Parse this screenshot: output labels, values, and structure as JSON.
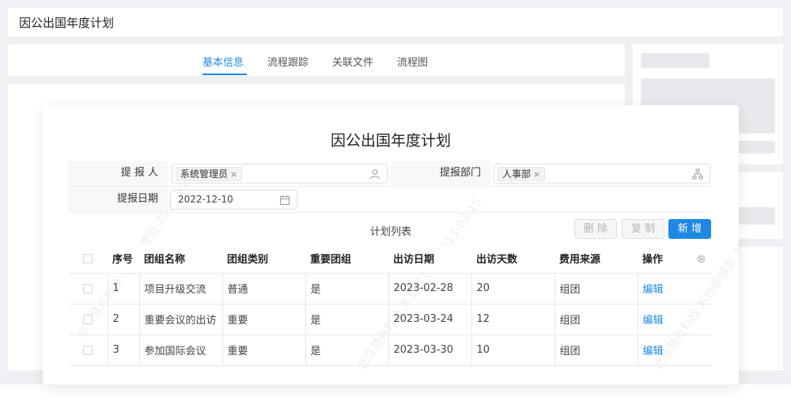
{
  "page": {
    "title": "因公出国年度计划"
  },
  "tabs": [
    {
      "label": "基本信息",
      "active": true
    },
    {
      "label": "流程跟踪",
      "active": false
    },
    {
      "label": "关联文件",
      "active": false
    },
    {
      "label": "流程图",
      "active": false
    }
  ],
  "modal": {
    "title": "因公出国年度计划",
    "form": {
      "reporter_label": "提 报 人",
      "reporter_value": "系统管理员",
      "dept_label": "提报部门",
      "dept_value": "人事部",
      "date_label": "提报日期",
      "date_value": "2022-12-10"
    },
    "toolbar": {
      "list_label": "计划列表",
      "delete_label": "删 除",
      "copy_label": "复 制",
      "add_label": "新 增"
    },
    "table": {
      "headers": [
        "序号",
        "团组名称",
        "团组类别",
        "重要团组",
        "出访日期",
        "出访天数",
        "费用来源",
        "操作"
      ],
      "rows": [
        {
          "no": "1",
          "name": "项目升级交流",
          "type": "普通",
          "important": "是",
          "date": "2023-02-28",
          "days": "20",
          "source": "组团",
          "action": "编辑"
        },
        {
          "no": "2",
          "name": "重要会议的出访",
          "type": "重要",
          "important": "是",
          "date": "2023-03-24",
          "days": "12",
          "source": "组团",
          "action": "编辑"
        },
        {
          "no": "3",
          "name": "参加国际会议",
          "type": "重要",
          "important": "是",
          "date": "2023-03-30",
          "days": "10",
          "source": "组团",
          "action": "编辑"
        }
      ]
    },
    "watermarks": [
      "北京慧点科技 系统管理员 2023-03-15",
      "北京慧点科技 系统管理员 2023-03-15",
      "北京慧点科技 系统管理员 2023-03-15"
    ]
  },
  "colors": {
    "accent": "#1e88e5",
    "background": "#eef0f3"
  },
  "icons": {
    "user_picker": "user-icon",
    "dept_picker": "org-tree-icon",
    "date_picker": "calendar-icon",
    "table_settings": "gear-icon"
  }
}
